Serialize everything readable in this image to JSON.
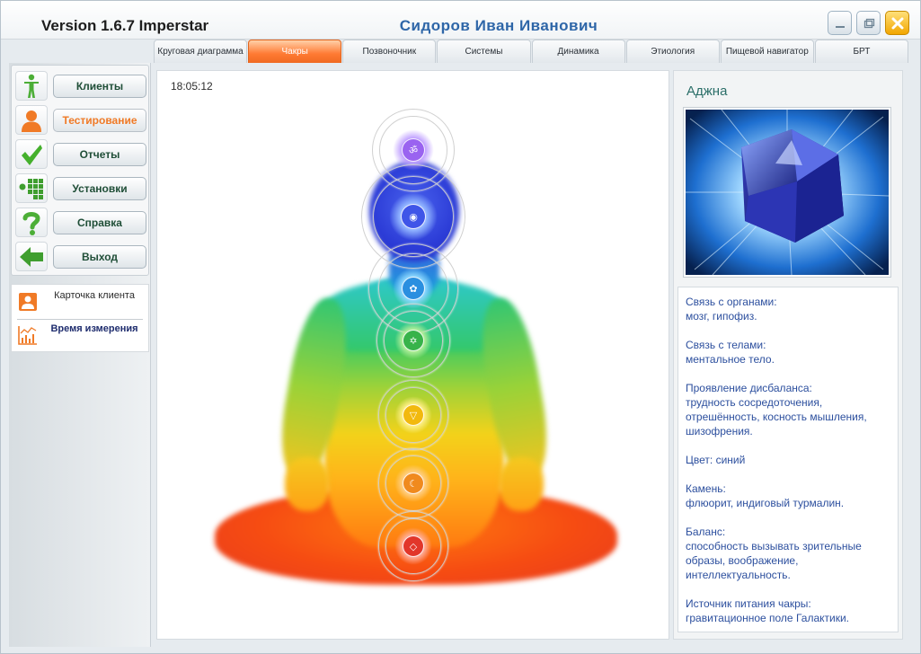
{
  "window": {
    "app_title": "Version 1.6.7 Imperstar",
    "user_name": "Сидоров  Иван  Иванович",
    "controls": [
      "minimize-icon",
      "restore-icon",
      "close-icon"
    ]
  },
  "tabs": [
    {
      "label": "Круговая диаграмма",
      "active": false
    },
    {
      "label": "Чакры",
      "active": true
    },
    {
      "label": "Позвоночник",
      "active": false
    },
    {
      "label": "Системы",
      "active": false
    },
    {
      "label": "Динамика",
      "active": false
    },
    {
      "label": "Этиология",
      "active": false
    },
    {
      "label": "Пищевой навигатор",
      "active": false
    },
    {
      "label": "БРТ",
      "active": false
    }
  ],
  "sidebar": {
    "items": [
      {
        "label": "Клиенты",
        "icon": "person-figure-icon"
      },
      {
        "label": "Тестирование",
        "icon": "user-orange-icon",
        "active": true
      },
      {
        "label": "Отчеты",
        "icon": "checkmark-icon"
      },
      {
        "label": "Установки",
        "icon": "grid-settings-icon"
      },
      {
        "label": "Справка",
        "icon": "question-icon"
      },
      {
        "label": "Выход",
        "icon": "exit-arrow-icon"
      }
    ],
    "info_items": [
      {
        "label": "Карточка клиента",
        "icon": "client-card-icon"
      },
      {
        "label": "Время измерения",
        "icon": "measurement-chart-icon"
      }
    ]
  },
  "main": {
    "time": "18:05:12"
  },
  "chakra_panel": {
    "name": "Аджна",
    "image_alt": "crystal-stone-image",
    "sections": [
      {
        "title": "Связь с органами:",
        "text": "мозг, гипофиз."
      },
      {
        "title": "Связь с телами:",
        "text": "ментальное тело."
      },
      {
        "title": "Проявление дисбаланса:",
        "text": "трудность сосредоточения, отрешённость, косность мышления, шизофрения."
      },
      {
        "title": "Цвет:",
        "text": "синий",
        "inline": true
      },
      {
        "title": "Камень:",
        "text": "флюорит, индиговый турмалин."
      },
      {
        "title": "Баланс:",
        "text": "способность вызывать зрительные образы, воображение, интеллектуальность."
      },
      {
        "title": "Источник питания чакры:",
        "text": "гравитационное поле Галактики."
      }
    ]
  },
  "colors": {
    "accent_orange": "#ff7a33",
    "title_blue": "#2e66a8",
    "text_blue": "#2c4f9e",
    "nav_green": "#1f4e37"
  }
}
